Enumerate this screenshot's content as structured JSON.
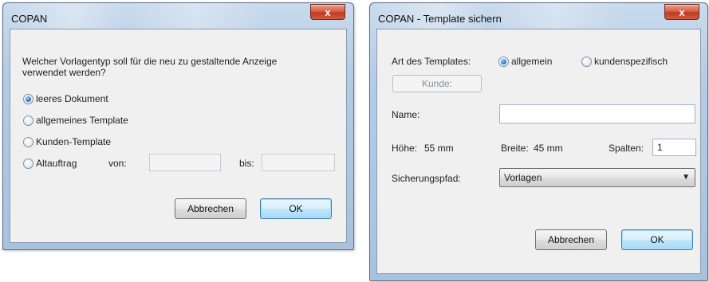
{
  "dialog1": {
    "title": "COPAN",
    "close_glyph": "x",
    "question_line1": "Welcher Vorlagentyp soll für die neu zu gestaltende Anzeige",
    "question_line2": "verwendet werden?",
    "options": [
      {
        "label": "leeres Dokument",
        "checked": true
      },
      {
        "label": "allgemeines Template",
        "checked": false
      },
      {
        "label": "Kunden-Template",
        "checked": false
      },
      {
        "label": "Altauftrag",
        "checked": false
      }
    ],
    "von_label": "von:",
    "von_value": "",
    "bis_label": "bis:",
    "bis_value": "",
    "cancel_label": "Abbrechen",
    "ok_label": "OK"
  },
  "dialog2": {
    "title": "COPAN - Template sichern",
    "close_glyph": "x",
    "art_label": "Art des Templates:",
    "art_options": [
      {
        "label": "allgemein",
        "checked": true
      },
      {
        "label": "kundenspezifisch",
        "checked": false
      }
    ],
    "kunde_button": "Kunde:",
    "name_label": "Name:",
    "name_value": "",
    "hoehe_label": "Höhe:",
    "hoehe_value": "55 mm",
    "breite_label": "Breite:",
    "breite_value": "45 mm",
    "spalten_label": "Spalten:",
    "spalten_value": "1",
    "pfad_label": "Sicherungspfad:",
    "pfad_value": "Vorlagen",
    "cancel_label": "Abbrechen",
    "ok_label": "OK"
  },
  "colors": {
    "accent": "#2f7fd4",
    "close_button": "#c1391f",
    "dialog_background": "#f0f0f0"
  },
  "icons": {
    "close": "close-icon",
    "dropdown": "chevron-down-icon"
  }
}
